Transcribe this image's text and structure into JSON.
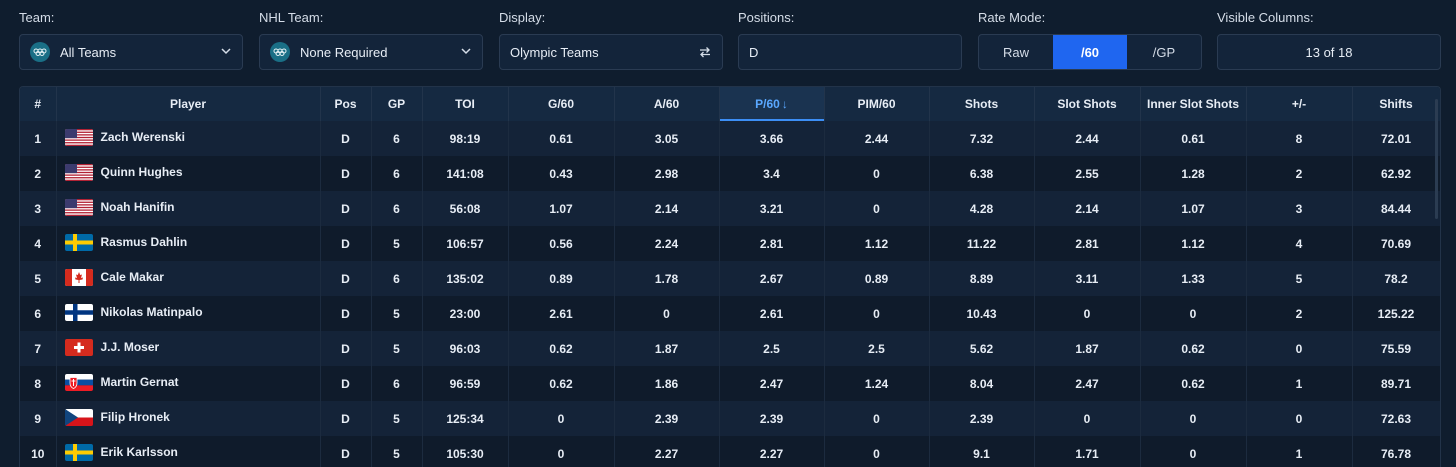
{
  "filters": {
    "team": {
      "label": "Team:",
      "value": "All Teams"
    },
    "nhl_team": {
      "label": "NHL Team:",
      "value": "None Required"
    },
    "display": {
      "label": "Display:",
      "value": "Olympic Teams"
    },
    "positions": {
      "label": "Positions:",
      "value": "D"
    },
    "rate_mode": {
      "label": "Rate Mode:",
      "options": [
        "Raw",
        "/60",
        "/GP"
      ],
      "active": "/60"
    },
    "visible_columns": {
      "label": "Visible Columns:",
      "value": "13 of 18"
    }
  },
  "table": {
    "columns": [
      "#",
      "Player",
      "Pos",
      "GP",
      "TOI",
      "G/60",
      "A/60",
      "P/60",
      "PIM/60",
      "Shots",
      "Slot Shots",
      "Inner Slot Shots",
      "+/-",
      "Shifts"
    ],
    "sorted_column": "P/60",
    "sort_arrow": "↓",
    "rows": [
      {
        "rank": "1",
        "flag": "usa",
        "player": "Zach Werenski",
        "pos": "D",
        "gp": "6",
        "toi": "98:19",
        "g60": "0.61",
        "a60": "3.05",
        "p60": "3.66",
        "pim60": "2.44",
        "shots": "7.32",
        "slot": "2.44",
        "inner": "0.61",
        "pm": "8",
        "shifts": "72.01"
      },
      {
        "rank": "2",
        "flag": "usa",
        "player": "Quinn Hughes",
        "pos": "D",
        "gp": "6",
        "toi": "141:08",
        "g60": "0.43",
        "a60": "2.98",
        "p60": "3.4",
        "pim60": "0",
        "shots": "6.38",
        "slot": "2.55",
        "inner": "1.28",
        "pm": "2",
        "shifts": "62.92"
      },
      {
        "rank": "3",
        "flag": "usa",
        "player": "Noah Hanifin",
        "pos": "D",
        "gp": "6",
        "toi": "56:08",
        "g60": "1.07",
        "a60": "2.14",
        "p60": "3.21",
        "pim60": "0",
        "shots": "4.28",
        "slot": "2.14",
        "inner": "1.07",
        "pm": "3",
        "shifts": "84.44"
      },
      {
        "rank": "4",
        "flag": "swe",
        "player": "Rasmus Dahlin",
        "pos": "D",
        "gp": "5",
        "toi": "106:57",
        "g60": "0.56",
        "a60": "2.24",
        "p60": "2.81",
        "pim60": "1.12",
        "shots": "11.22",
        "slot": "2.81",
        "inner": "1.12",
        "pm": "4",
        "shifts": "70.69"
      },
      {
        "rank": "5",
        "flag": "can",
        "player": "Cale Makar",
        "pos": "D",
        "gp": "6",
        "toi": "135:02",
        "g60": "0.89",
        "a60": "1.78",
        "p60": "2.67",
        "pim60": "0.89",
        "shots": "8.89",
        "slot": "3.11",
        "inner": "1.33",
        "pm": "5",
        "shifts": "78.2"
      },
      {
        "rank": "6",
        "flag": "fin",
        "player": "Nikolas Matinpalo",
        "pos": "D",
        "gp": "5",
        "toi": "23:00",
        "g60": "2.61",
        "a60": "0",
        "p60": "2.61",
        "pim60": "0",
        "shots": "10.43",
        "slot": "0",
        "inner": "0",
        "pm": "2",
        "shifts": "125.22"
      },
      {
        "rank": "7",
        "flag": "sui",
        "player": "J.J. Moser",
        "pos": "D",
        "gp": "5",
        "toi": "96:03",
        "g60": "0.62",
        "a60": "1.87",
        "p60": "2.5",
        "pim60": "2.5",
        "shots": "5.62",
        "slot": "1.87",
        "inner": "0.62",
        "pm": "0",
        "shifts": "75.59"
      },
      {
        "rank": "8",
        "flag": "svk",
        "player": "Martin Gernat",
        "pos": "D",
        "gp": "6",
        "toi": "96:59",
        "g60": "0.62",
        "a60": "1.86",
        "p60": "2.47",
        "pim60": "1.24",
        "shots": "8.04",
        "slot": "2.47",
        "inner": "0.62",
        "pm": "1",
        "shifts": "89.71"
      },
      {
        "rank": "9",
        "flag": "cze",
        "player": "Filip Hronek",
        "pos": "D",
        "gp": "5",
        "toi": "125:34",
        "g60": "0",
        "a60": "2.39",
        "p60": "2.39",
        "pim60": "0",
        "shots": "2.39",
        "slot": "0",
        "inner": "0",
        "pm": "0",
        "shifts": "72.63"
      },
      {
        "rank": "10",
        "flag": "swe",
        "player": "Erik Karlsson",
        "pos": "D",
        "gp": "5",
        "toi": "105:30",
        "g60": "0",
        "a60": "2.27",
        "p60": "2.27",
        "pim60": "0",
        "shots": "9.1",
        "slot": "1.71",
        "inner": "0",
        "pm": "1",
        "shifts": "76.78"
      }
    ]
  }
}
